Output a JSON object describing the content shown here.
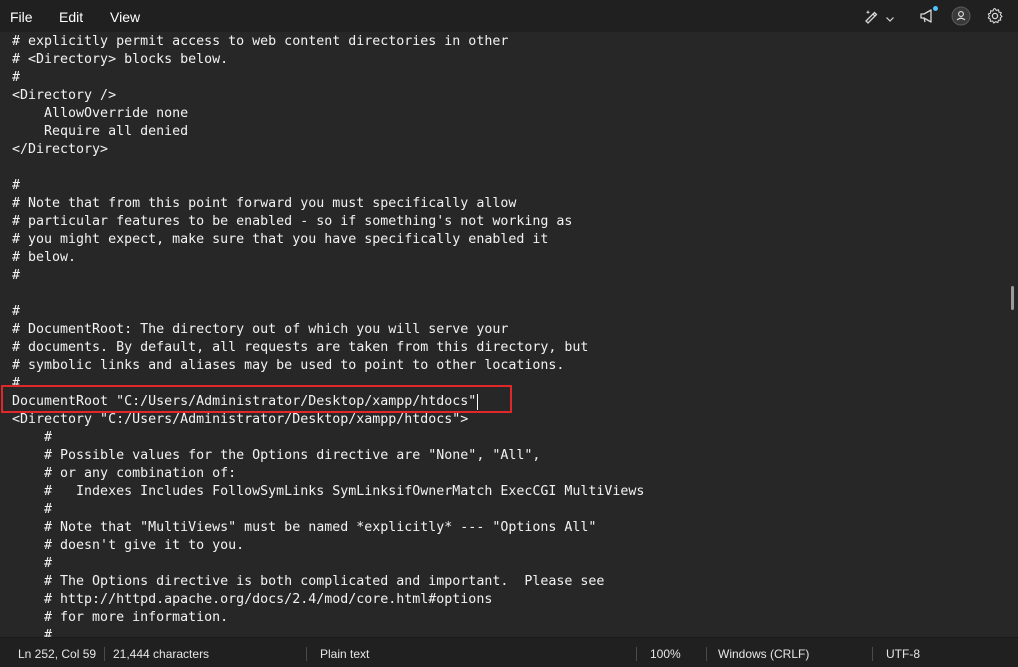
{
  "menu": {
    "file": "File",
    "edit": "Edit",
    "view": "View"
  },
  "toolbar": {
    "icons": [
      "copilot-pen-icon",
      "chevron-down-icon",
      "megaphone-icon",
      "account-icon",
      "settings-gear-icon"
    ],
    "notification_dot_color": "#4cc2ff"
  },
  "editor": {
    "lines": [
      "# explicitly permit access to web content directories in other",
      "# <Directory> blocks below.",
      "#",
      "<Directory />",
      "    AllowOverride none",
      "    Require all denied",
      "</Directory>",
      "",
      "#",
      "# Note that from this point forward you must specifically allow",
      "# particular features to be enabled - so if something's not working as",
      "# you might expect, make sure that you have specifically enabled it",
      "# below.",
      "#",
      "",
      "#",
      "# DocumentRoot: The directory out of which you will serve your",
      "# documents. By default, all requests are taken from this directory, but",
      "# symbolic links and aliases may be used to point to other locations.",
      "#",
      "DocumentRoot \"C:/Users/Administrator/Desktop/xampp/htdocs\"",
      "<Directory \"C:/Users/Administrator/Desktop/xampp/htdocs\">",
      "    #",
      "    # Possible values for the Options directive are \"None\", \"All\",",
      "    # or any combination of:",
      "    #   Indexes Includes FollowSymLinks SymLinksifOwnerMatch ExecCGI MultiViews",
      "    #",
      "    # Note that \"MultiViews\" must be named *explicitly* --- \"Options All\"",
      "    # doesn't give it to you.",
      "    #",
      "    # The Options directive is both complicated and important.  Please see",
      "    # http://httpd.apache.org/docs/2.4/mod/core.html#options",
      "    # for more information.",
      "    #"
    ],
    "highlight_color": "#e0282b"
  },
  "status": {
    "position": "Ln 252, Col 59",
    "characters": "21,444 characters",
    "format": "Plain text",
    "zoom": "100%",
    "line_ending": "Windows (CRLF)",
    "encoding": "UTF-8"
  }
}
